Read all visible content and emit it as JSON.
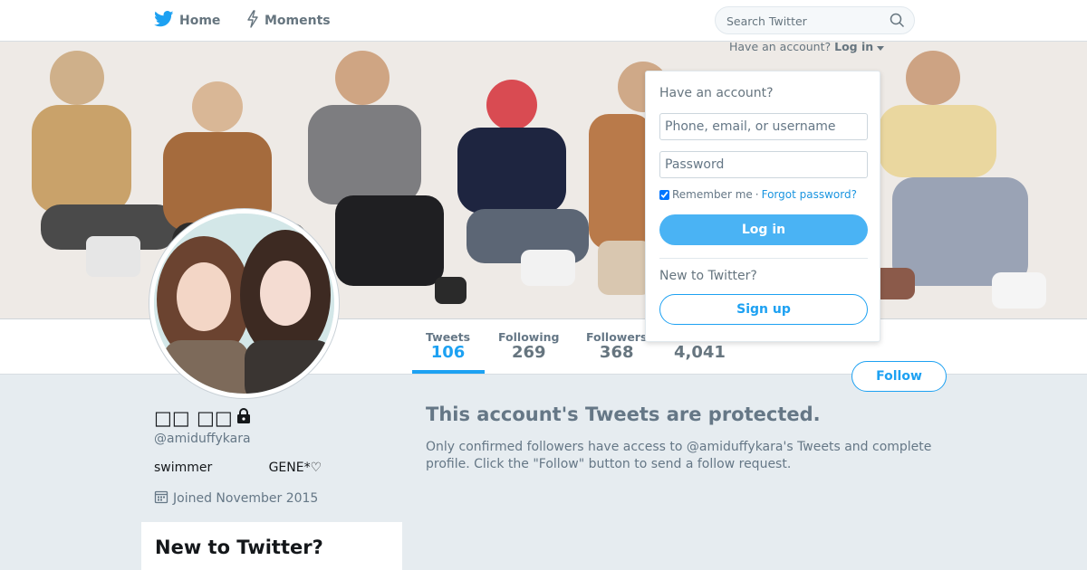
{
  "nav": {
    "home_label": "Home",
    "moments_label": "Moments",
    "search_placeholder": "Search Twitter"
  },
  "account_hint": {
    "prompt": "Have an account?",
    "login_label": "Log in"
  },
  "login_dropdown": {
    "heading": "Have an account?",
    "username_placeholder": "Phone, email, or username",
    "password_placeholder": "Password",
    "remember_label": "Remember me",
    "separator": "·",
    "forgot_label": "Forgot password?",
    "login_button": "Log in",
    "new_heading": "New to Twitter?",
    "signup_button": "Sign up"
  },
  "stats": [
    {
      "label": "Tweets",
      "value": "106"
    },
    {
      "label": "Following",
      "value": "269"
    },
    {
      "label": "Followers",
      "value": "368"
    },
    {
      "label": "",
      "value": "4,041"
    }
  ],
  "follow_button": "Follow",
  "profile": {
    "name": "□□ □□",
    "handle": "@amiduffykara",
    "bio": "swimmer              GENE*♡",
    "joined": "Joined November 2015"
  },
  "signup_card": {
    "title": "New to Twitter?"
  },
  "protected": {
    "title": "This account's Tweets are protected.",
    "text": "Only confirmed followers have access to @amiduffykara's Tweets and complete profile. Click the \"Follow\" button to send a follow request."
  },
  "colors": {
    "brand": "#1da1f2",
    "background": "#e6ecf0"
  },
  "icons": [
    "twitter-bird-icon",
    "moments-bolt-icon",
    "search-icon",
    "caret-down-icon",
    "lock-icon",
    "calendar-icon"
  ]
}
